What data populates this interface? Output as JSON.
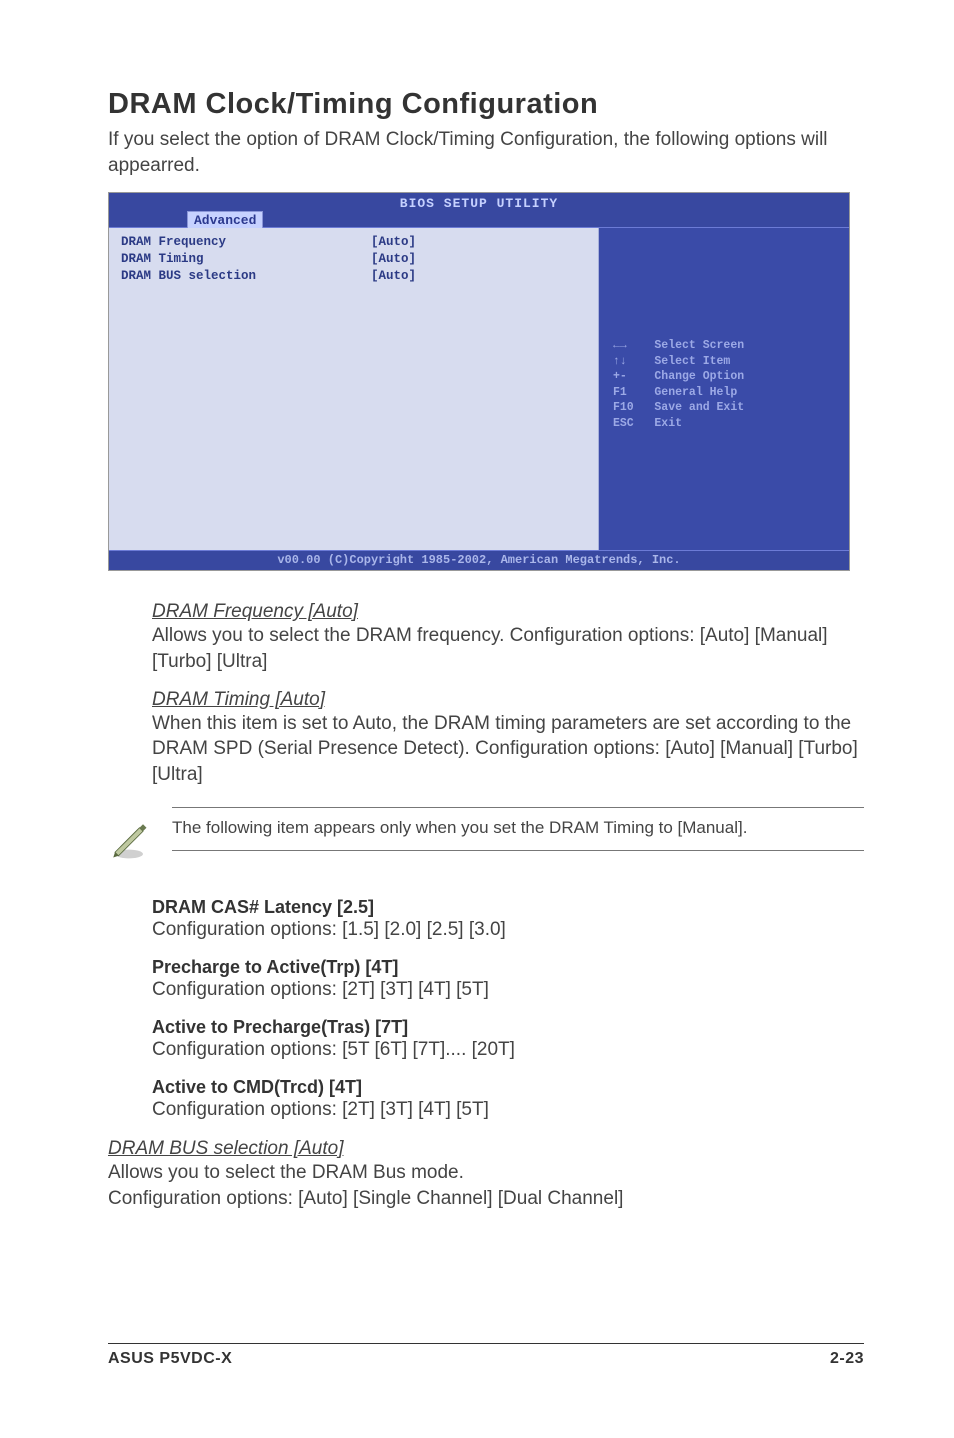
{
  "title": "DRAM Clock/Timing Configuration",
  "intro": "If you select the option of DRAM Clock/Timing Configuration, the following options will appearred.",
  "bios": {
    "header_title": "BIOS SETUP UTILITY",
    "tab": "Advanced",
    "rows": [
      {
        "label": "DRAM Frequency",
        "value": "[Auto]"
      },
      {
        "label": "DRAM Timing",
        "value": "[Auto]"
      },
      {
        "label": "DRAM BUS selection",
        "value": "[Auto]"
      }
    ],
    "help": "←→    Select Screen\n↑↓    Select Item\n+-    Change Option\nF1    General Help\nF10   Save and Exit\nESC   Exit",
    "footer": "v00.00 (C)Copyright 1985-2002, American Megatrends, Inc."
  },
  "dram_frequency": {
    "head": "DRAM Frequency [Auto]",
    "body": "Allows you to select the DRAM frequency. Configuration options: [Auto] [Manual] [Turbo] [Ultra]"
  },
  "dram_timing": {
    "head": "DRAM Timing [Auto]",
    "body": "When this item is set to Auto, the DRAM timing parameters are set according to the DRAM SPD (Serial Presence Detect). Configuration options: [Auto] [Manual] [Turbo] [Ultra]"
  },
  "note": "The following item appears only when you set the DRAM Timing to [Manual].",
  "options": [
    {
      "title": "DRAM CAS# Latency [2.5]",
      "body": "Configuration options: [1.5] [2.0] [2.5] [3.0]"
    },
    {
      "title": "Precharge to Active(Trp) [4T]",
      "body": "Configuration options: [2T] [3T] [4T] [5T]"
    },
    {
      "title": "Active to Precharge(Tras) [7T]",
      "body": "Configuration options: [5T [6T] [7T].... [20T]"
    },
    {
      "title": "Active to CMD(Trcd) [4T]",
      "body": "Configuration options: [2T] [3T] [4T] [5T]"
    }
  ],
  "dram_bus": {
    "head": "DRAM BUS selection [Auto]",
    "body1": "Allows you to select the DRAM Bus mode.",
    "body2": "Configuration options: [Auto] [Single Channel] [Dual Channel]"
  },
  "footer": {
    "left": "ASUS P5VDC-X",
    "right": "2-23"
  }
}
